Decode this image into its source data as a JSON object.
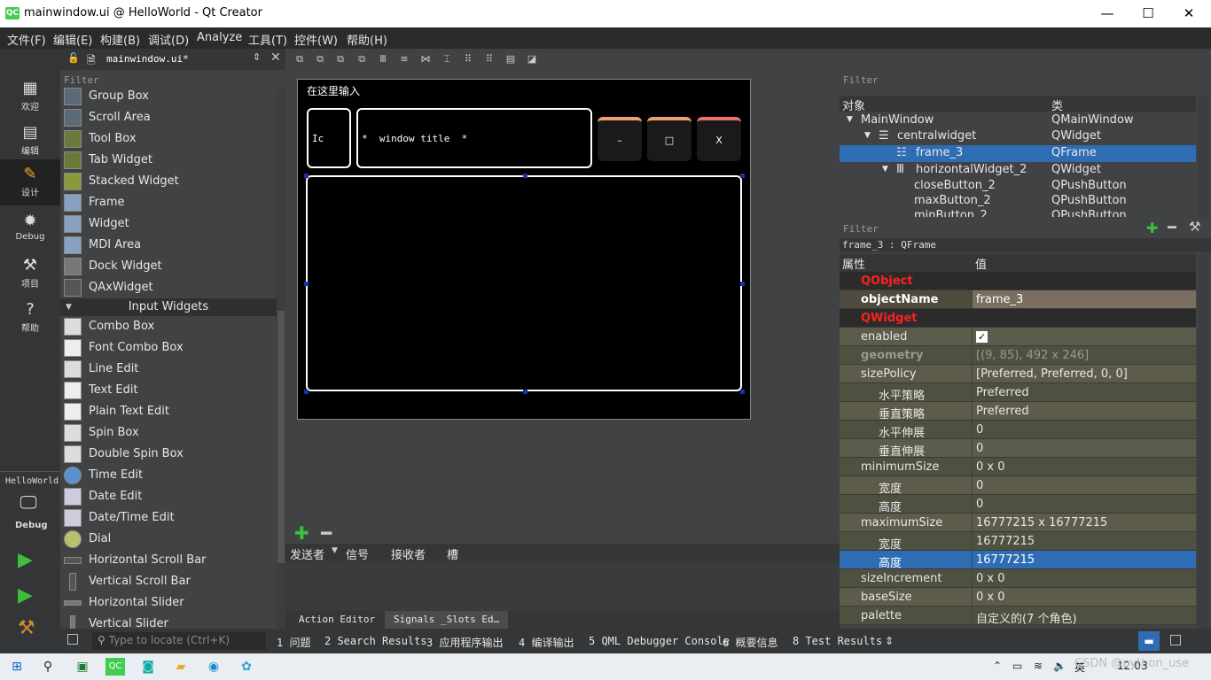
{
  "window": {
    "title": "mainwindow.ui @ HelloWorld - Qt Creator",
    "app_icon": "QC",
    "min": "—",
    "max": "☐",
    "close": "✕"
  },
  "menu": [
    "文件(F)",
    "编辑(E)",
    "构建(B)",
    "调试(D)",
    "Analyze",
    "工具(T)",
    "控件(W)",
    "帮助(H)"
  ],
  "modes": [
    {
      "label": "欢迎",
      "icon": "grid-icon"
    },
    {
      "label": "编辑",
      "icon": "document-icon"
    },
    {
      "label": "设计",
      "icon": "pencil-icon"
    },
    {
      "label": "Debug",
      "icon": "bug-icon"
    },
    {
      "label": "项目",
      "icon": "wrench-icon"
    },
    {
      "label": "帮助",
      "icon": "help-icon"
    }
  ],
  "kit": {
    "project": "HelloWorld",
    "config": "Debug"
  },
  "editor_tab": {
    "file": "mainwindow.ui*"
  },
  "widget_box": {
    "filter_placeholder": "Filter",
    "containers": [
      "Group Box",
      "Scroll Area",
      "Tool Box",
      "Tab Widget",
      "Stacked Widget",
      "Frame",
      "Widget",
      "MDI Area",
      "Dock Widget",
      "QAxWidget"
    ],
    "input_category": "Input Widgets",
    "inputs": [
      "Combo Box",
      "Font Combo Box",
      "Line Edit",
      "Text Edit",
      "Plain Text Edit",
      "Spin Box",
      "Double Spin Box",
      "Time Edit",
      "Date Edit",
      "Date/Time Edit",
      "Dial",
      "Horizontal Scroll Bar",
      "Vertical Scroll Bar",
      "Horizontal Slider",
      "Vertical Slider"
    ]
  },
  "form": {
    "menu_placeholder": "在这里输入",
    "icon_label": "Ic",
    "title_label": "*  window title  *",
    "min_button": "–",
    "max_button": "□",
    "close_button": "X"
  },
  "signal_slot": {
    "headers": [
      "发送者",
      "信号",
      "接收者",
      "槽"
    ],
    "tabs": [
      "Action Editor",
      "Signals _Slots Ed…"
    ]
  },
  "object_inspector": {
    "filter_placeholder": "Filter",
    "headers": [
      "对象",
      "类"
    ],
    "rows": [
      {
        "name": "MainWindow",
        "cls": "QMainWindow"
      },
      {
        "name": "centralwidget",
        "cls": "QWidget"
      },
      {
        "name": "frame_3",
        "cls": "QFrame"
      },
      {
        "name": "horizontalWidget_2",
        "cls": "QWidget"
      },
      {
        "name": "closeButton_2",
        "cls": "QPushButton"
      },
      {
        "name": "maxButton_2",
        "cls": "QPushButton"
      },
      {
        "name": "minButton_2",
        "cls": "QPushButton"
      }
    ]
  },
  "property_editor": {
    "filter_placeholder": "Filter",
    "context": "frame_3 : QFrame",
    "headers": [
      "属性",
      "值"
    ],
    "rows": [
      {
        "name": "QObject",
        "value": ""
      },
      {
        "name": "objectName",
        "value": "frame_3"
      },
      {
        "name": "QWidget",
        "value": ""
      },
      {
        "name": "enabled",
        "value": "✓"
      },
      {
        "name": "geometry",
        "value": "[(9, 85), 492 x 246]"
      },
      {
        "name": "sizePolicy",
        "value": "[Preferred, Preferred, 0, 0]"
      },
      {
        "name": "水平策略",
        "value": "Preferred"
      },
      {
        "name": "垂直策略",
        "value": "Preferred"
      },
      {
        "name": "水平伸展",
        "value": "0"
      },
      {
        "name": "垂直伸展",
        "value": "0"
      },
      {
        "name": "minimumSize",
        "value": "0 x 0"
      },
      {
        "name": "宽度",
        "value": "0"
      },
      {
        "name": "高度",
        "value": "0"
      },
      {
        "name": "maximumSize",
        "value": "16777215 x 16777215"
      },
      {
        "name": "宽度",
        "value": "16777215"
      },
      {
        "name": "高度",
        "value": "16777215"
      },
      {
        "name": "sizeIncrement",
        "value": "0 x 0"
      },
      {
        "name": "baseSize",
        "value": "0 x 0"
      },
      {
        "name": "palette",
        "value": "自定义的(7 个角色)"
      }
    ]
  },
  "status": {
    "locate_placeholder": "Type to locate (Ctrl+K)",
    "panes": [
      "1 问题",
      "2 Search Results",
      "3 应用程序输出",
      "4 编译输出",
      "5 QML Debugger Console",
      "6 概要信息",
      "8 Test Results"
    ]
  },
  "taskbar": {
    "watermark": "CSDN @python_use",
    "time": "12:03"
  }
}
